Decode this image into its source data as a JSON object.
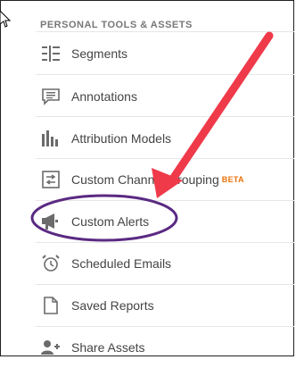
{
  "panel": {
    "section_title": "PERSONAL TOOLS & ASSETS",
    "items": [
      {
        "label": "Segments",
        "icon": "segments-icon"
      },
      {
        "label": "Annotations",
        "icon": "annotations-icon"
      },
      {
        "label": "Attribution Models",
        "icon": "attribution-models-icon"
      },
      {
        "label": "Custom Channel Grouping",
        "badge": "BETA",
        "icon": "custom-channel-grouping-icon"
      },
      {
        "label": "Custom Alerts",
        "icon": "megaphone-icon"
      },
      {
        "label": "Scheduled Emails",
        "icon": "alarm-clock-icon"
      },
      {
        "label": "Saved Reports",
        "icon": "document-icon"
      },
      {
        "label": "Share Assets",
        "icon": "add-user-icon"
      }
    ]
  },
  "colors": {
    "arrow": "#ef3a4a",
    "highlight_ellipse": "#5a2a82",
    "badge": "#e8710a"
  }
}
